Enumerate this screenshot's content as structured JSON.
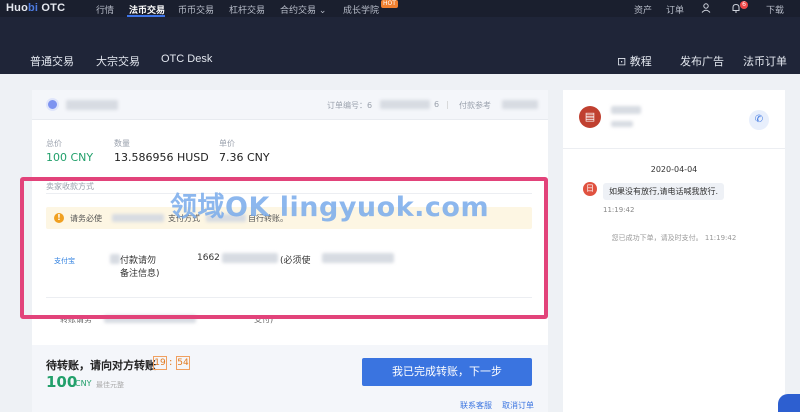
{
  "topbar": {
    "logo_a": "Huo",
    "logo_b": "bi",
    "logo_c": " OTC",
    "nav": [
      "行情",
      "法币交易",
      "币币交易",
      "杠杆交易",
      "合约交易",
      "成长学院"
    ],
    "hot_badge": "HOT",
    "right": [
      "资产",
      "订单",
      "下载"
    ],
    "bell_count": "6"
  },
  "subnav": {
    "left": [
      "普通交易",
      "大宗交易",
      "OTC Desk"
    ],
    "right": [
      "教程",
      "发布广告",
      "法币订单"
    ]
  },
  "order": {
    "order_no_label": "订单编号：",
    "order_no_visible": "6",
    "order_no_tail": "6",
    "ref_label": "付款参考",
    "total_label": "总价",
    "total_value": "100 CNY",
    "qty_label": "数量",
    "qty_value": "13.586956 HUSD",
    "price_label": "单价",
    "price_value": "7.36 CNY"
  },
  "payment": {
    "section_title": "卖家收款方式",
    "notice_a": "请务必使",
    "notice_b": "支付方式",
    "notice_c": "自行转账。",
    "method": "支付宝",
    "row_text_a": "付款请勿",
    "row_text_b": "备注信息)",
    "account_prefix": "1662",
    "note": "(必须使",
    "terms_a": "转账请务",
    "terms_b": "支付)"
  },
  "bottom": {
    "pending": "待转账，请向对方转账",
    "timer_min": "19",
    "timer_sec": "54",
    "amount": "100",
    "amount_unit": "CNY",
    "amount_note": "最佳元整",
    "done_button": "我已完成转账，下一步",
    "contact": "联系客服",
    "cancel": "取消订单"
  },
  "chat": {
    "date": "2020-04-04",
    "message": "如果没有放行,请电话喊我放行.",
    "message_time": "11:19:42",
    "system": "您已成功下单，请及时支付。 11:19:42",
    "avatar_char": "日"
  },
  "watermark": "领域OK lingyuok.com"
}
